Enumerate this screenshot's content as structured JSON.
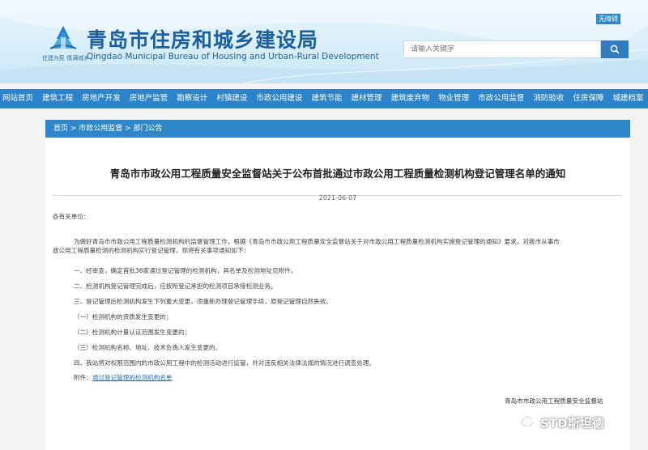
{
  "header": {
    "site_title": "青岛市住房和城乡建设局",
    "site_subtitle": "Qingdao Municipal Bureau of Housing and Urban-Rural Development",
    "slogan": "住建为民 情满城乡",
    "barrier_free": "无障碍",
    "search_placeholder": "请输入关键字"
  },
  "nav": {
    "items": [
      "网站首页",
      "建筑工程",
      "房地产开发",
      "房地产监管",
      "勘察设计",
      "村镇建设",
      "市政公用建设",
      "建筑节能",
      "建材管理",
      "建筑废弃物",
      "物业管理",
      "市政公用监督",
      "消防验收",
      "住房保障",
      "城建档案"
    ]
  },
  "breadcrumb": {
    "home": "首页",
    "level1": "市政公用监督",
    "level2": "部门公告",
    "sep": " > "
  },
  "article": {
    "title": "青岛市市政公用工程质量安全监督站关于公布首批通过市政公用工程质量检测机构登记管理名单的通知",
    "date": "2021-06-07",
    "greeting": "各有关单位:",
    "intro_line1": "为做好青岛市市政公用工程质量检测机构的监督管理工作，根据《青岛市市政公用工程质量安全监督站关于对市政公用工程质量检测机构实施登记管理的通知》要求，对我市从事市",
    "intro_line2": "政公用工程质量检测的检测机构实行登记管理，现将有关事项通知如下：",
    "item1": "一、经审查，确定首批36家通过登记管理的检测机构，其名单及检测地址见附件。",
    "item2": "二、检测机构登记管理完成后，应按所登记承担的检测项目承接检测业务。",
    "item3": "三、登记管理后检测机构发生下列重大变更，须重新办理登记管理手续，原登记管理自然失效。",
    "sub1": "（一）检测机构的资质发生变更的；",
    "sub2": "（二）检测机构计量认证范围发生变更的；",
    "sub3": "（三）检测机构名称、地址、技术负责人发生变更的。",
    "item4": "四、我站将对权限范围内的市政公用工程中的检测活动进行监管，并对违反相关法律法规的情况进行调查处理。",
    "attachment_label": "附件：",
    "attachment_link": "通过登记管理的检测机构名单",
    "signature": "青岛市市政公用工程质量安全监督站"
  },
  "watermark": {
    "text": "STD斯坦德"
  },
  "colors": {
    "nav_bg": "#2c83c9",
    "breadcrumb_bg": "#2f86c9",
    "title_blue": "#1b5f9f",
    "link_blue": "#2a6fb3"
  }
}
